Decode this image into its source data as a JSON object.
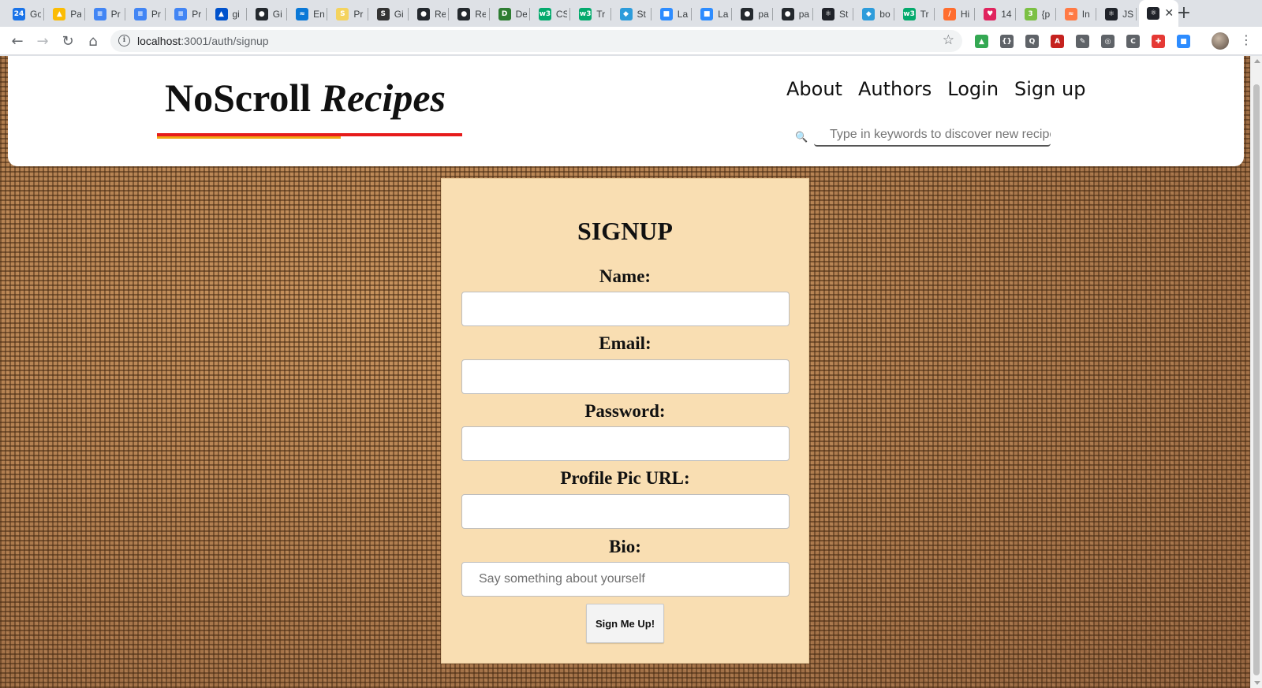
{
  "browser": {
    "tabs": [
      {
        "title": "Go",
        "color": "#1a73e8",
        "glyph": "24"
      },
      {
        "title": "Pa",
        "color": "#fbbc04",
        "glyph": "▲"
      },
      {
        "title": "Pr",
        "color": "#4285f4",
        "glyph": "≡"
      },
      {
        "title": "Pr",
        "color": "#4285f4",
        "glyph": "≡"
      },
      {
        "title": "Pr",
        "color": "#4285f4",
        "glyph": "≡"
      },
      {
        "title": "gi",
        "color": "#0052cc",
        "glyph": "▲"
      },
      {
        "title": "Gi",
        "color": "#24292e",
        "glyph": "●"
      },
      {
        "title": "En",
        "color": "#0a78d7",
        "glyph": "≈"
      },
      {
        "title": "Pr",
        "color": "#f4d35e",
        "glyph": "S"
      },
      {
        "title": "Gi",
        "color": "#333333",
        "glyph": "S"
      },
      {
        "title": "Re",
        "color": "#24292e",
        "glyph": "●"
      },
      {
        "title": "Re",
        "color": "#24292e",
        "glyph": "●"
      },
      {
        "title": "De",
        "color": "#2e7d32",
        "glyph": "D"
      },
      {
        "title": "CS",
        "color": "#04aa6d",
        "glyph": "w3"
      },
      {
        "title": "Tr",
        "color": "#04aa6d",
        "glyph": "w3"
      },
      {
        "title": "St",
        "color": "#2d9cdb",
        "glyph": "◆"
      },
      {
        "title": "La",
        "color": "#2d8cff",
        "glyph": "■"
      },
      {
        "title": "La",
        "color": "#2d8cff",
        "glyph": "■"
      },
      {
        "title": "pa",
        "color": "#24292e",
        "glyph": "●"
      },
      {
        "title": "pa",
        "color": "#24292e",
        "glyph": "●"
      },
      {
        "title": "St",
        "color": "#20232a",
        "glyph": "⚛"
      },
      {
        "title": "bo",
        "color": "#2d9cdb",
        "glyph": "◆"
      },
      {
        "title": "Tr",
        "color": "#04aa6d",
        "glyph": "w3"
      },
      {
        "title": "Hi",
        "color": "#ff6d2e",
        "glyph": "/"
      },
      {
        "title": "14",
        "color": "#e0245e",
        "glyph": "♥"
      },
      {
        "title": "{p",
        "color": "#7bc043",
        "glyph": "3"
      },
      {
        "title": "In",
        "color": "#ff7a45",
        "glyph": "≈"
      },
      {
        "title": "JS",
        "color": "#20232a",
        "glyph": "⚛"
      }
    ],
    "active_tab": {
      "color": "#20232a",
      "glyph": "⚛",
      "close": "✕"
    },
    "new_tab": "+",
    "url_host": "localhost",
    "url_path": ":3001/auth/signup",
    "extensions": [
      {
        "color": "#34a853",
        "glyph": "▲"
      },
      {
        "color": "#5f6368",
        "glyph": "{}"
      },
      {
        "color": "#5f6368",
        "glyph": "Q"
      },
      {
        "color": "#c5221f",
        "glyph": "A"
      },
      {
        "color": "#5f6368",
        "glyph": "✎"
      },
      {
        "color": "#5f6368",
        "glyph": "◎"
      },
      {
        "color": "#5f6368",
        "glyph": "C"
      },
      {
        "color": "#e53935",
        "glyph": "✚"
      },
      {
        "color": "#2d8cff",
        "glyph": "■"
      }
    ]
  },
  "site": {
    "logo_plain": "NoScroll",
    "logo_italic": "Recipes",
    "nav": [
      "About",
      "Authors",
      "Login",
      "Sign up"
    ],
    "search_placeholder": "Type in keywords to discover new recipes",
    "search_icon": "🔍"
  },
  "signup": {
    "title": "SIGNUP",
    "fields": [
      {
        "label": "Name:",
        "value": "",
        "placeholder": ""
      },
      {
        "label": "Email:",
        "value": "",
        "placeholder": ""
      },
      {
        "label": "Password:",
        "value": "",
        "placeholder": ""
      },
      {
        "label": "Profile Pic URL:",
        "value": "",
        "placeholder": ""
      },
      {
        "label": "Bio:",
        "value": "",
        "placeholder": "Say something about yourself"
      }
    ],
    "submit_label": "Sign Me Up!"
  },
  "colors": {
    "card_bg": "#f9deb2",
    "logo_rule": "#e61b1b",
    "logo_rule_accent": "#f2a516",
    "burlap": "#b07d4e"
  }
}
